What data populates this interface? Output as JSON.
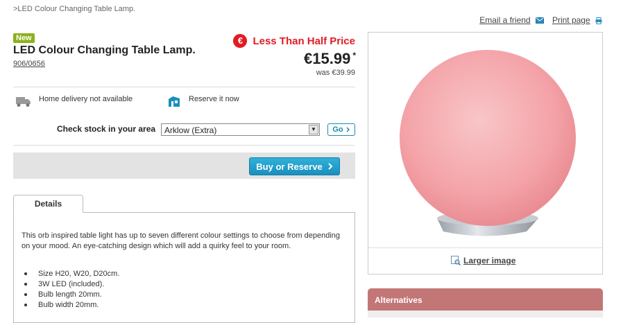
{
  "breadcrumb": ">LED Colour Changing Table Lamp.",
  "top_actions": {
    "email_label": "Email a friend",
    "print_label": "Print page"
  },
  "product": {
    "badge": "New",
    "title": "LED Colour Changing Table Lamp.",
    "code": "906/0656",
    "promo_symbol": "€",
    "promo_text": "Less Than Half Price",
    "price": "€15.99",
    "price_mark": "*",
    "was_price": "was €39.99"
  },
  "services": {
    "delivery": "Home delivery not available",
    "reserve": "Reserve it now"
  },
  "stock": {
    "label": "Check stock in your area",
    "selected": "Arklow (Extra)",
    "go_label": "Go"
  },
  "buy": {
    "label": "Buy or Reserve"
  },
  "details": {
    "tab_label": "Details",
    "description": "This orb inspired table light has up to seven different colour settings to choose from depending on your mood. An eye-catching design which will add a quirky feel to your room.",
    "features": [
      "Size H20, W20, D20cm.",
      "3W LED (included).",
      "Bulb length 20mm.",
      "Bulb width 20mm."
    ]
  },
  "image": {
    "larger_label": "Larger image"
  },
  "alternatives": {
    "title": "Alternatives"
  },
  "colors": {
    "brand_blue": "#1a8fbd",
    "promo_red": "#e21b23",
    "new_green": "#8bb21c",
    "alternatives_header": "#c37676",
    "lamp_pink": "#f4a3a8"
  },
  "icons": [
    "email-icon",
    "print-icon",
    "euro-icon",
    "truck-icon",
    "reserve-icon",
    "dropdown-arrow-icon",
    "chevron-right-icon",
    "magnifier-icon"
  ]
}
